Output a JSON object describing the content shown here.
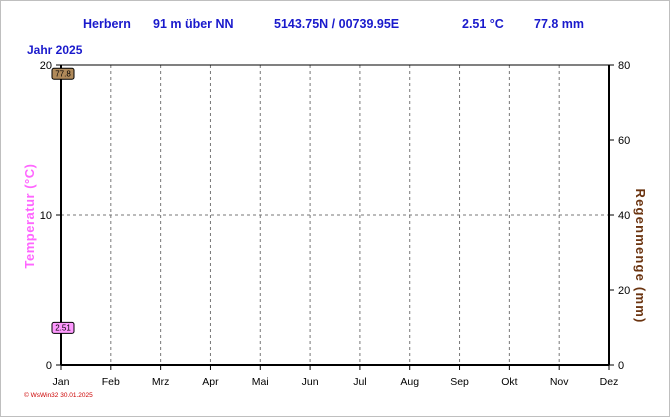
{
  "header": {
    "station": "Herbern",
    "altitude": "91 m über NN",
    "coordinates": "5143.75N / 00739.95E",
    "temperature": "2.51 °C",
    "rain": "77.8 mm"
  },
  "year_label": "Jahr 2025",
  "footer": "© WsWin32  30.01.2025",
  "colors": {
    "header_text": "#1a1acc",
    "temp_axis": "#ff66ff",
    "rain_axis": "#6b3410",
    "temp_marker_bg": "#ff99ff",
    "rain_marker_bg": "#b08a5a"
  },
  "chart_data": {
    "type": "line",
    "categories": [
      "Jan",
      "Feb",
      "Mrz",
      "Apr",
      "Mai",
      "Jun",
      "Jul",
      "Aug",
      "Sep",
      "Okt",
      "Nov",
      "Dez"
    ],
    "ylabel": "Temperatur (°C)",
    "ylabel_right": "Regenmenge (mm)",
    "ylim": [
      0,
      20
    ],
    "ylim_right": [
      0,
      80
    ],
    "yticks": [
      0,
      10,
      20
    ],
    "yticks_right": [
      0,
      20,
      40,
      60,
      80
    ],
    "grid": true,
    "series": [
      {
        "name": "Temperatur",
        "axis": "left",
        "current": 2.51,
        "marker_label": "2.51"
      },
      {
        "name": "Regenmenge",
        "axis": "right",
        "current": 77.8,
        "marker_label": "77.8"
      }
    ]
  }
}
